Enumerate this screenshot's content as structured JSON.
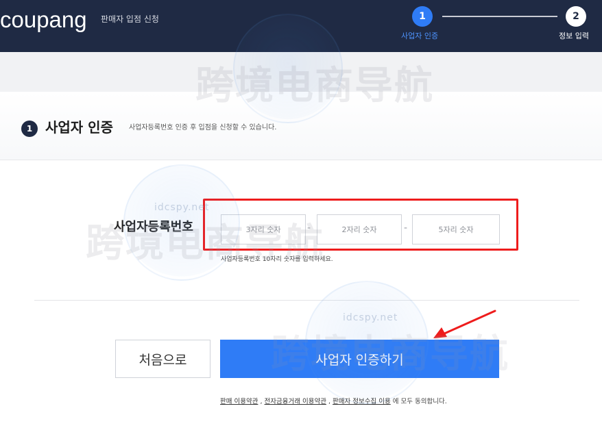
{
  "header": {
    "logo": "coupang",
    "subtitle": "판매자 입점 신청",
    "steps": [
      {
        "number": "1",
        "label": "사업자 인증"
      },
      {
        "number": "2",
        "label": "정보 입력"
      }
    ]
  },
  "section": {
    "number": "1",
    "title": "사업자 인증",
    "description": "사업자등록번호 인증 후 입점을 신청할 수 있습니다."
  },
  "form": {
    "label": "사업자등록번호",
    "inputs": [
      {
        "placeholder": "3자리 숫자",
        "value": ""
      },
      {
        "placeholder": "2자리 숫자",
        "value": ""
      },
      {
        "placeholder": "5자리 숫자",
        "value": ""
      }
    ],
    "separator": "-",
    "hint": "사업자등록번호 10자리 숫자를 입력하세요."
  },
  "buttons": {
    "back": "처음으로",
    "verify": "사업자 인증하기"
  },
  "agreement": {
    "link1": "판매 이용약관",
    "sep1": " , ",
    "link2": "전자금융거래 이용약관",
    "sep2": " , ",
    "link3": "판매자 정보수집 이용",
    "suffix": " 에 모두 동의합니다."
  },
  "watermark": {
    "text": "跨境电商导航",
    "url": "idcspy.net"
  },
  "colors": {
    "header_bg": "#1f2a44",
    "primary_blue": "#2f7cf6",
    "highlight_red": "#ee1c1c"
  }
}
